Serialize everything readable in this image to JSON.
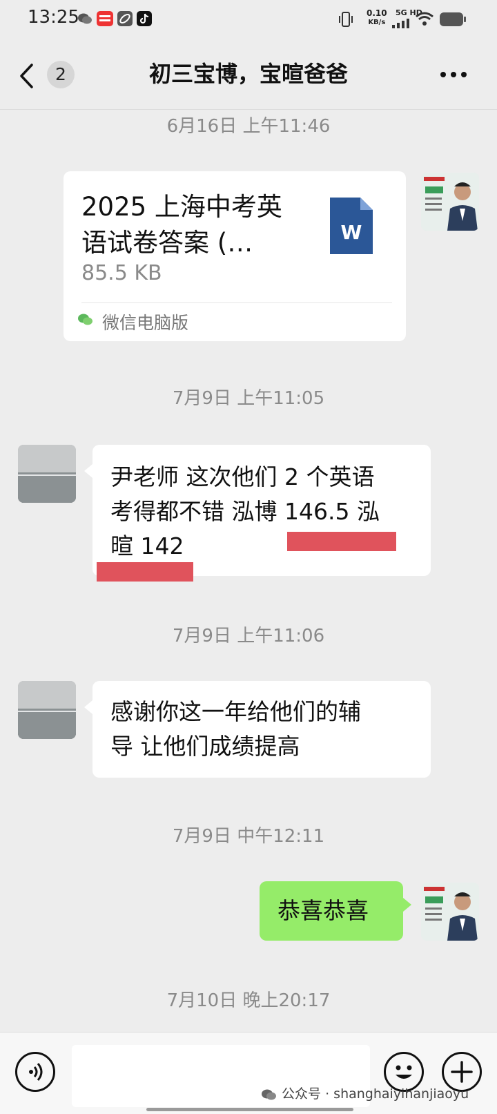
{
  "status_bar": {
    "time": "13:25",
    "icons": [
      "wechat-icon",
      "news-app-icon",
      "link-app-icon",
      "tiktok-icon",
      "vibrate-icon",
      "signal-icon",
      "wifi-icon",
      "battery-icon"
    ],
    "net_speed_value": "0.10",
    "net_speed_unit": "KB/s",
    "network_label": "5G HD"
  },
  "nav": {
    "unread_count": "2",
    "title": "初三宝博，宝暄爸爸"
  },
  "messages": [
    {
      "type": "time",
      "text": "6月16日 上午11:46"
    },
    {
      "type": "file",
      "file_title": "2025 上海中考英语试卷答案 (…",
      "file_title_line1": "2025 上海中考英",
      "file_title_line2": "语试卷答案 (…",
      "file_size": "85.5 KB",
      "file_icon_letter": "W",
      "source": "微信电脑版",
      "sender": "self"
    },
    {
      "type": "time",
      "text": "7月9日 上午11:05"
    },
    {
      "type": "text",
      "sender": "other",
      "line1": "尹老师 这次他们 2 个英语",
      "line2": "考得都不错 泓博 146.5 泓",
      "line3": "暄 142"
    },
    {
      "type": "time",
      "text": "7月9日 上午11:06"
    },
    {
      "type": "text",
      "sender": "other",
      "line1": "感谢你这一年给他们的辅",
      "line2": "导 让他们成绩提高"
    },
    {
      "type": "time",
      "text": "7月9日 中午12:11"
    },
    {
      "type": "text",
      "sender": "self",
      "line1": "恭喜恭喜"
    },
    {
      "type": "time",
      "text": "7月10日 晚上20:17"
    }
  ],
  "input_bar": {
    "watermark": "公众号 · shanghaiyihanjiaoyu"
  },
  "colors": {
    "background": "#ededed",
    "self_bubble": "#95ec69",
    "highlight": "#e0535c",
    "word_blue": "#2b5797"
  }
}
